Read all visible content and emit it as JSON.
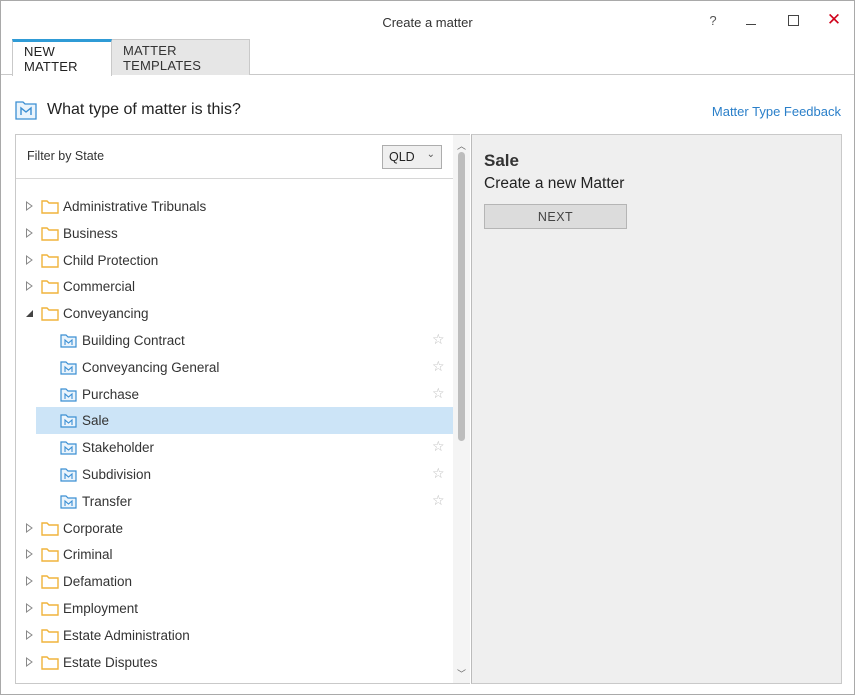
{
  "window": {
    "title": "Create a matter",
    "help_glyph": "?",
    "close_glyph": "✕"
  },
  "tabs": [
    {
      "label": "NEW MATTER",
      "active": true
    },
    {
      "label": "MATTER TEMPLATES",
      "active": false
    }
  ],
  "header": {
    "question": "What type of matter is this?",
    "feedback_link": "Matter Type Feedback"
  },
  "filter": {
    "label": "Filter by State",
    "selected_state": "QLD"
  },
  "tree": {
    "items": [
      {
        "label": "Administrative Tribunals",
        "expanded": false
      },
      {
        "label": "Business",
        "expanded": false
      },
      {
        "label": "Child Protection",
        "expanded": false
      },
      {
        "label": "Commercial",
        "expanded": false
      },
      {
        "label": "Conveyancing",
        "expanded": true,
        "children": [
          {
            "label": "Building Contract"
          },
          {
            "label": "Conveyancing General"
          },
          {
            "label": "Purchase"
          },
          {
            "label": "Sale",
            "selected": true
          },
          {
            "label": "Stakeholder"
          },
          {
            "label": "Subdivision"
          },
          {
            "label": "Transfer"
          }
        ]
      },
      {
        "label": "Corporate",
        "expanded": false
      },
      {
        "label": "Criminal",
        "expanded": false
      },
      {
        "label": "Defamation",
        "expanded": false
      },
      {
        "label": "Employment",
        "expanded": false
      },
      {
        "label": "Estate Administration",
        "expanded": false
      },
      {
        "label": "Estate Disputes",
        "expanded": false
      }
    ]
  },
  "detail": {
    "title": "Sale",
    "subtitle": "Create a new Matter",
    "next_label": "NEXT"
  },
  "colors": {
    "accent": "#2f9bd6",
    "link": "#2a7fc9",
    "selected_row": "#cce4f7",
    "folder": "#f0b43c",
    "close": "#d0021b"
  }
}
